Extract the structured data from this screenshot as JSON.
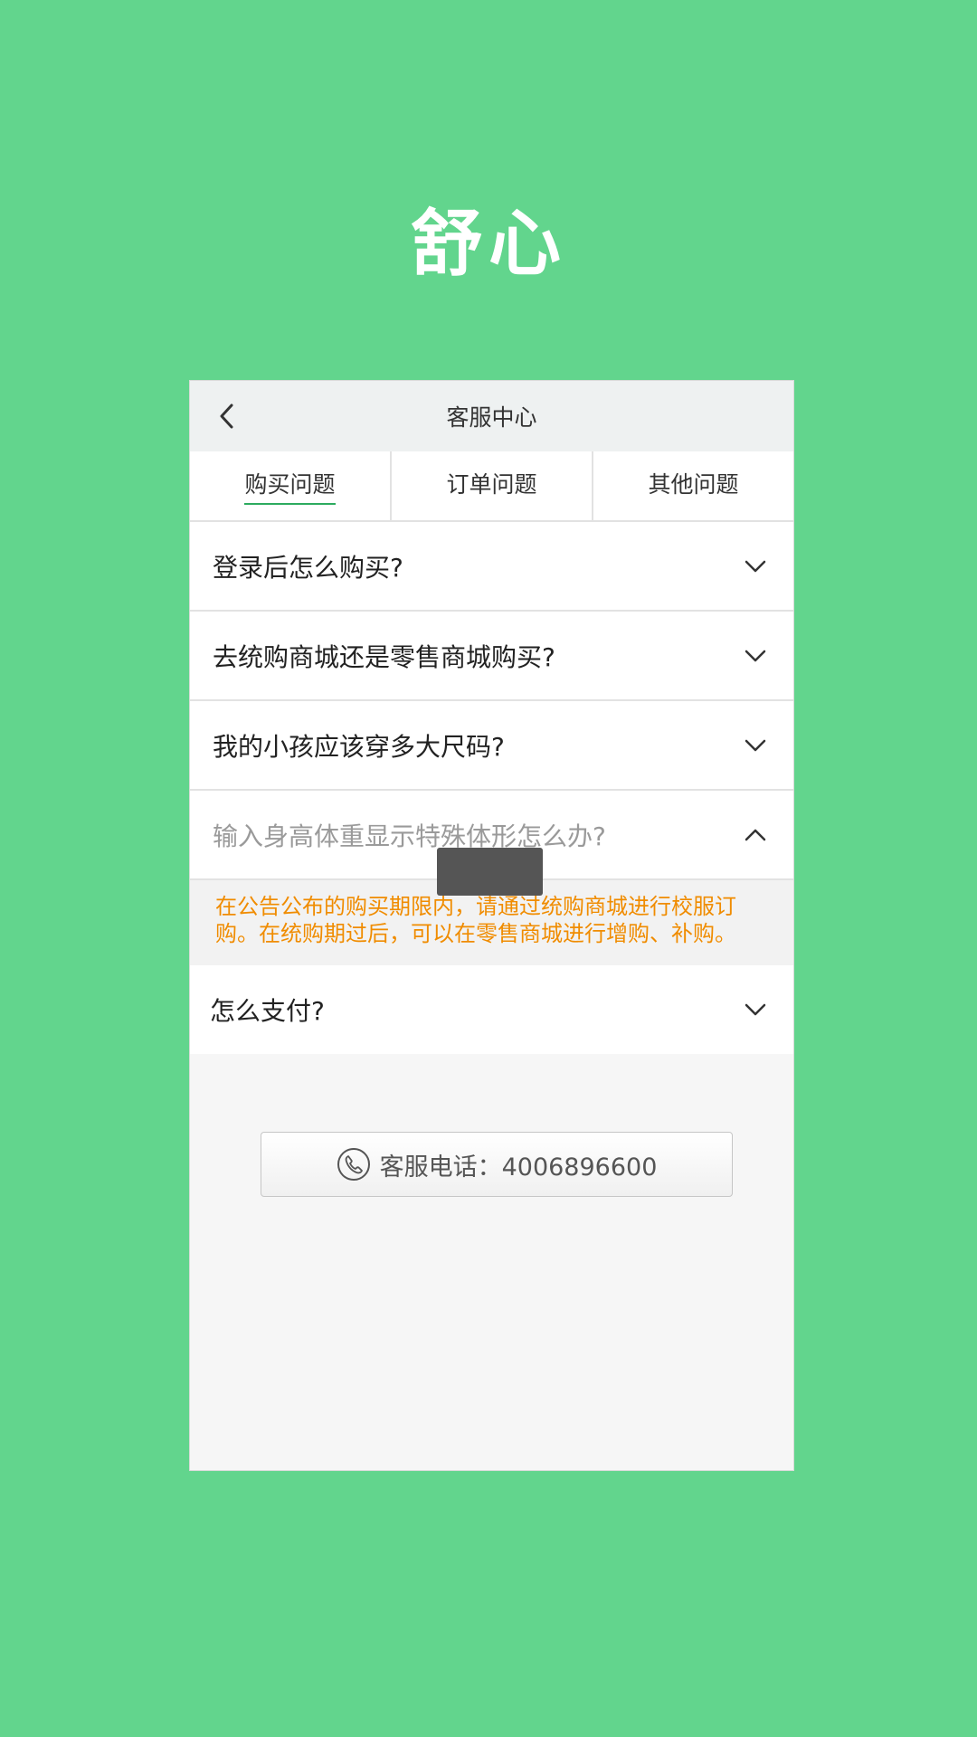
{
  "app": {
    "brand": "舒心"
  },
  "header": {
    "title": "客服中心",
    "back_icon": "chevron-left-icon"
  },
  "tabs": [
    {
      "label": "购买问题",
      "active": true
    },
    {
      "label": "订单问题",
      "active": false
    },
    {
      "label": "其他问题",
      "active": false
    }
  ],
  "faq": [
    {
      "question": "登录后怎么购买?",
      "expanded": false
    },
    {
      "question": "去统购商城还是零售商城购买?",
      "expanded": false
    },
    {
      "question": "我的小孩应该穿多大尺码?",
      "expanded": false
    },
    {
      "question": "输入身高体重显示特殊体形怎么办?",
      "expanded": true,
      "answer": "在公告公布的购买期限内，请通过统购商城进行校服订购。在统购期过后，可以在零售商城进行增购、补购。"
    },
    {
      "question": "怎么支付?",
      "expanded": false
    }
  ],
  "contact": {
    "label": "客服电话：4006896600",
    "icon": "phone-icon"
  },
  "colors": {
    "background": "#62d58d",
    "accent": "#2dab5f",
    "answer_text": "#f08c00"
  }
}
